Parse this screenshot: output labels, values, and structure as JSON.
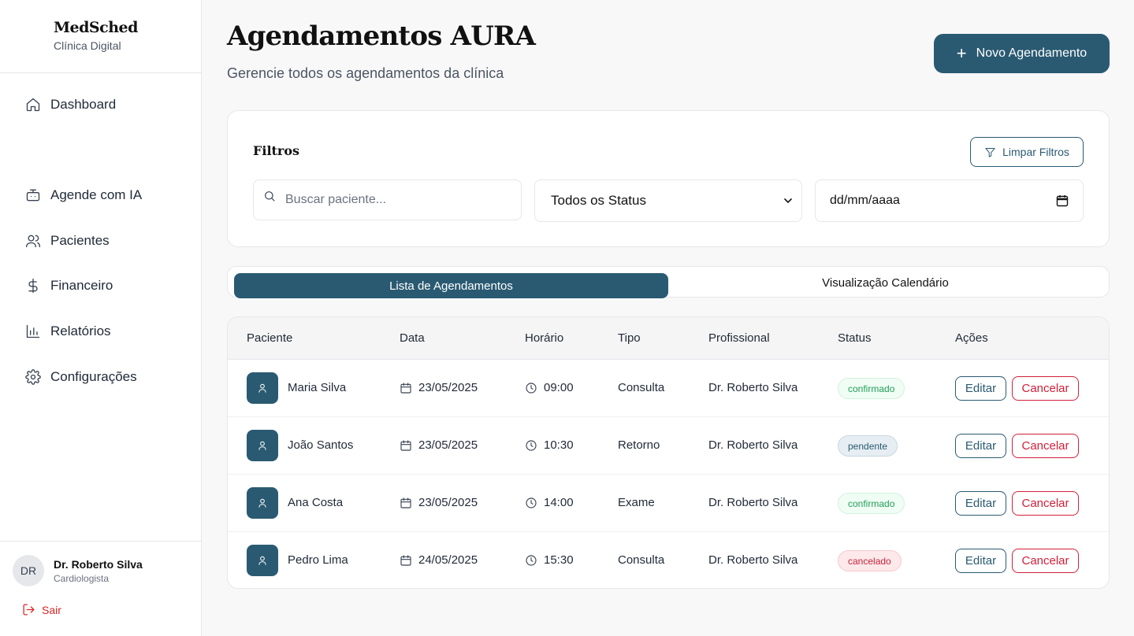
{
  "brand": {
    "name": "MedSched",
    "subtitle": "Clínica Digital"
  },
  "nav": [
    {
      "label": "Dashboard",
      "icon": "home-icon"
    },
    {
      "label": "Agende com IA",
      "icon": "bot-icon"
    },
    {
      "label": "Pacientes",
      "icon": "users-icon"
    },
    {
      "label": "Financeiro",
      "icon": "dollar-icon"
    },
    {
      "label": "Relatórios",
      "icon": "bar-chart-icon"
    },
    {
      "label": "Configurações",
      "icon": "gear-icon"
    }
  ],
  "user": {
    "initials": "DR",
    "name": "Dr. Roberto Silva",
    "role": "Cardiologista",
    "logout_label": "Sair"
  },
  "header": {
    "title": "Agendamentos AURA",
    "subtitle": "Gerencie todos os agendamentos da clínica",
    "new_button": "Novo Agendamento"
  },
  "filters": {
    "title": "Filtros",
    "clear_button": "Limpar Filtros",
    "search_placeholder": "Buscar paciente...",
    "status_value": "Todos os Status",
    "date_value": "dd/mm/aaaa"
  },
  "tabs": {
    "list": "Lista de Agendamentos",
    "calendar": "Visualização Calendário"
  },
  "table": {
    "headers": [
      "Paciente",
      "Data",
      "Horário",
      "Tipo",
      "Profissional",
      "Status",
      "Ações"
    ],
    "rows": [
      {
        "patient": "Maria Silva",
        "date": "23/05/2025",
        "time": "09:00",
        "type": "Consulta",
        "professional": "Dr. Roberto Silva",
        "status": "confirmado"
      },
      {
        "patient": "João Santos",
        "date": "23/05/2025",
        "time": "10:30",
        "type": "Retorno",
        "professional": "Dr. Roberto Silva",
        "status": "pendente"
      },
      {
        "patient": "Ana Costa",
        "date": "23/05/2025",
        "time": "14:00",
        "type": "Exame",
        "professional": "Dr. Roberto Silva",
        "status": "confirmado"
      },
      {
        "patient": "Pedro Lima",
        "date": "24/05/2025",
        "time": "15:30",
        "type": "Consulta",
        "professional": "Dr. Roberto Silva",
        "status": "cancelado"
      }
    ],
    "edit_label": "Editar",
    "cancel_label": "Cancelar"
  },
  "colors": {
    "primary": "#2a5a72",
    "danger": "#d0203a",
    "success": "#22a05a"
  }
}
